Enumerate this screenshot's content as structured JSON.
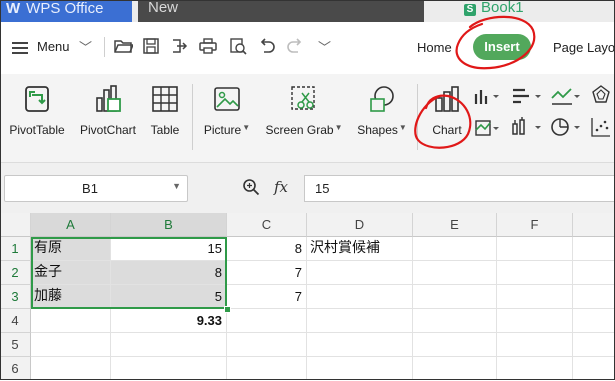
{
  "tabs": {
    "app": "WPS Office",
    "new": "New",
    "book": "Book1",
    "book_icon": "S"
  },
  "menu": {
    "menu_label": "Menu",
    "home": "Home",
    "insert": "Insert",
    "page_layout": "Page Layo"
  },
  "ribbon": {
    "pivot_table": "PivotTable",
    "pivot_chart": "PivotChart",
    "table": "Table",
    "picture": "Picture",
    "screen_grab": "Screen Grab",
    "shapes": "Shapes",
    "chart": "Chart"
  },
  "formula_bar": {
    "cell_ref": "B1",
    "fx": "fx",
    "value": "15"
  },
  "sheet": {
    "columns": [
      "A",
      "B",
      "C",
      "D",
      "E",
      "F"
    ],
    "rows": [
      "1",
      "2",
      "3",
      "4",
      "5",
      "6"
    ],
    "cells": {
      "A1": "有原",
      "B1": "15",
      "C1": "8",
      "D1": "沢村賞候補",
      "A2": "金子",
      "B2": "8",
      "C2": "7",
      "A3": "加藤",
      "B3": "5",
      "C3": "7",
      "B4": "9.33"
    }
  },
  "colors": {
    "accent_green": "#52a85c",
    "selection_green": "#2f9a48",
    "wps_blue": "#3b6fd3",
    "annotation_red": "#e01818"
  },
  "icons": [
    "menu-icon",
    "open-icon",
    "save-icon",
    "export-icon",
    "print-icon",
    "preview-icon",
    "undo-icon",
    "redo-icon",
    "more-icon",
    "zoom-icon"
  ]
}
